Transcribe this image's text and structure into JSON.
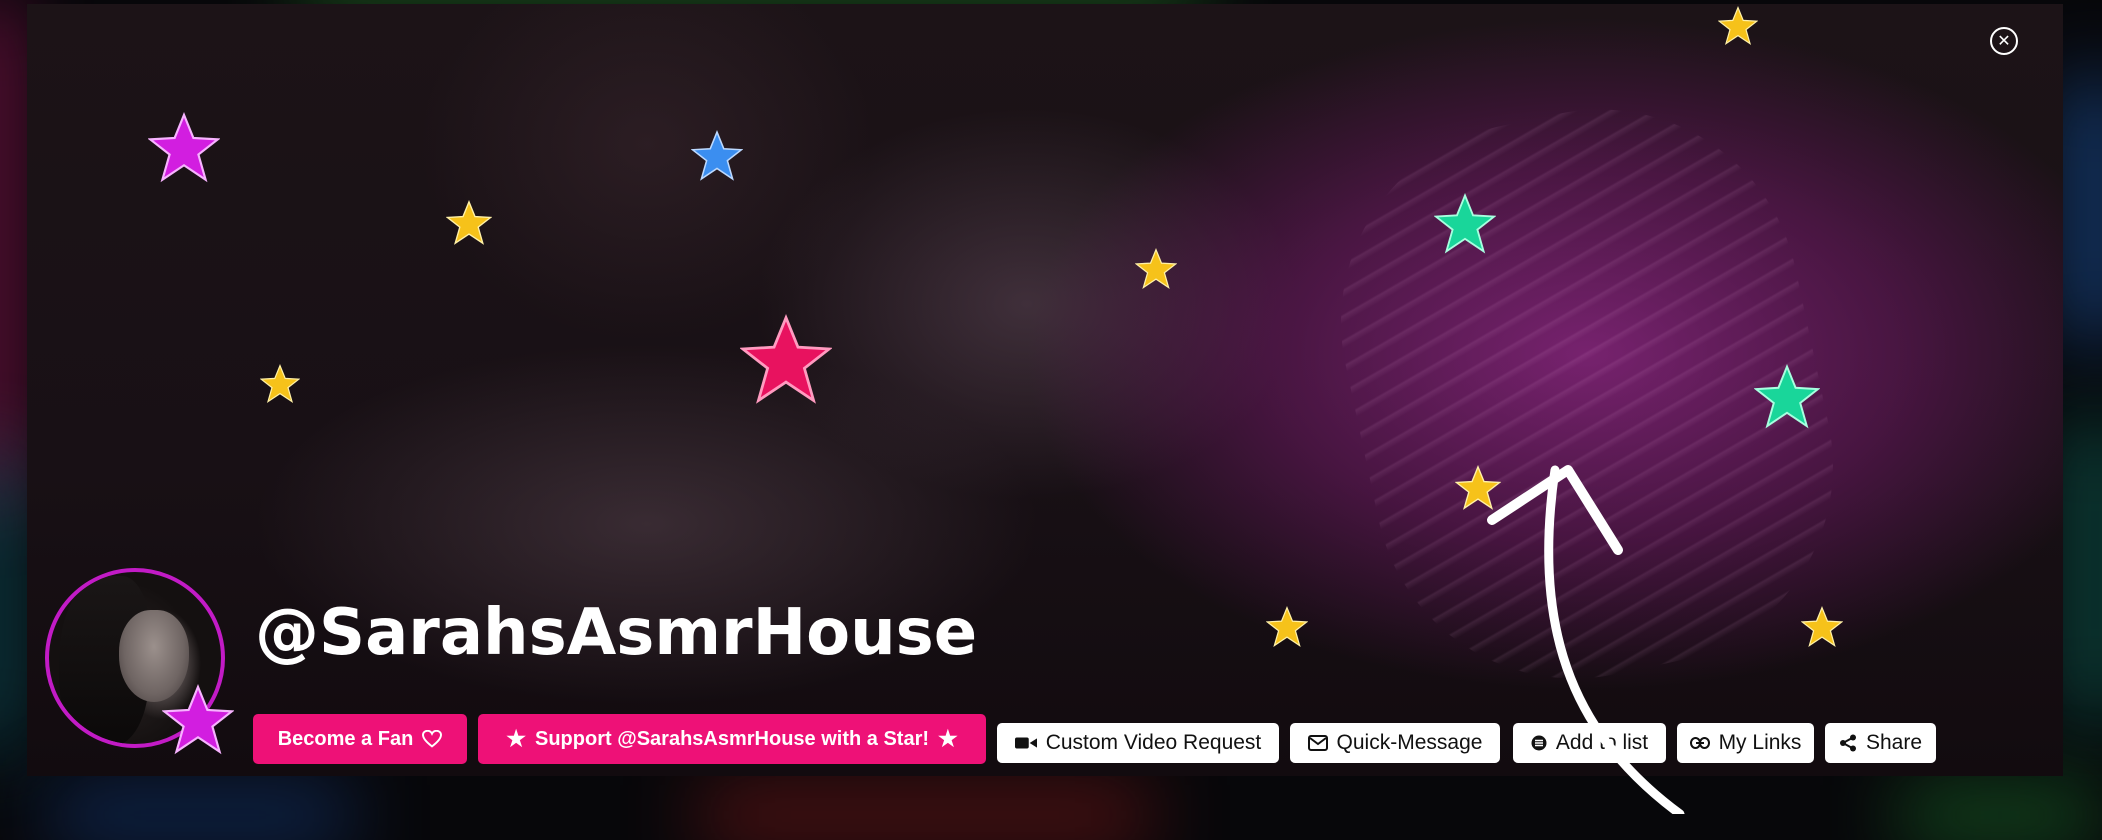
{
  "profile": {
    "username": "@SarahsAsmrHouse",
    "avatar_alt": "profile photo"
  },
  "actions": {
    "become_fan": "Become a Fan",
    "support_star": "Support @SarahsAsmrHouse with a Star!",
    "custom_video": "Custom Video Request",
    "quick_message": "Quick-Message",
    "add_to_list": "Add to list",
    "my_links": "My Links",
    "share": "Share"
  },
  "icons": {
    "close": "close-icon",
    "heart": "heart-icon",
    "star": "star-icon",
    "video": "video-camera-icon",
    "mail": "envelope-icon",
    "list": "list-icon",
    "link": "link-icon",
    "share": "share-icon"
  },
  "colors": {
    "accent_pink": "#ee1177",
    "avatar_ring": "#c21bc6",
    "star_gold": "#f6c21a",
    "star_magenta": "#d21ee0",
    "star_blue": "#3b8ef0",
    "star_green": "#19d69a",
    "star_pink": "#e8125f"
  }
}
